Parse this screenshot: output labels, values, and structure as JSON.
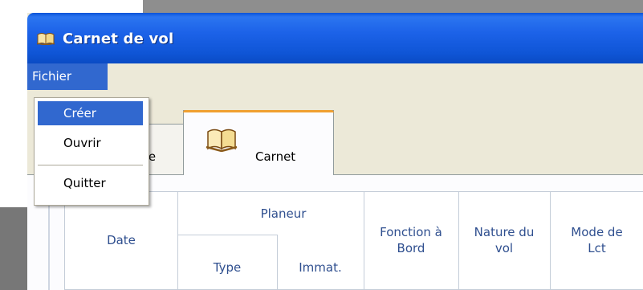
{
  "window": {
    "title": "Carnet de vol"
  },
  "menubar": {
    "fichier": "Fichier"
  },
  "file_menu": {
    "items": [
      "Créer",
      "Ouvrir",
      "Quitter"
    ]
  },
  "tabs": [
    {
      "label": "Liste",
      "visible_fragment": "te",
      "selected": false
    },
    {
      "label": "Carnet",
      "selected": true
    }
  ],
  "table": {
    "headers": {
      "date": "Date",
      "planeur": "Planeur",
      "type": "Type",
      "immat": "Immat.",
      "fonction_line1": "Fonction à",
      "fonction_line2": "Bord",
      "nature_line1": "Nature du",
      "nature_line2": "vol",
      "mode_line1": "Mode de",
      "mode_line2": "Lct"
    }
  },
  "icons": {
    "title": "book-icon",
    "tab_carnet": "book-icon"
  },
  "colors": {
    "titlebar": "#1c62e8",
    "menu_highlight": "#3168cf",
    "tab_accent": "#f0a030",
    "header_text": "#2f4f8f"
  }
}
